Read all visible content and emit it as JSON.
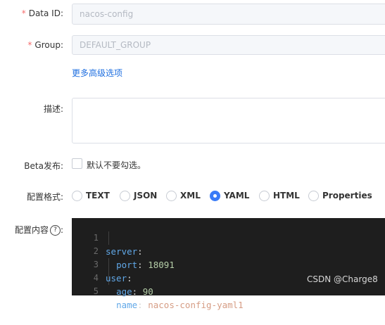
{
  "form": {
    "data_id": {
      "required_mark": "*",
      "label": "Data ID:",
      "value": "nacos-config"
    },
    "group": {
      "required_mark": "*",
      "label": "Group:",
      "value": "DEFAULT_GROUP"
    },
    "advanced_link": "更多高级选项",
    "description": {
      "label": "描述:",
      "value": ""
    },
    "beta": {
      "label": "Beta发布:",
      "checkbox_label": "默认不要勾选。",
      "checked": false
    },
    "format": {
      "label": "配置格式:",
      "options": [
        "TEXT",
        "JSON",
        "XML",
        "YAML",
        "HTML",
        "Properties"
      ],
      "selected": "YAML"
    },
    "content": {
      "label": "配置内容",
      "help_icon": "question-circle-icon",
      "lines": [
        {
          "num": "1",
          "key": "server",
          "sep": ":",
          "value": ""
        },
        {
          "num": "2",
          "key": "port",
          "sep": ": ",
          "value": "18091"
        },
        {
          "num": "3",
          "key": "user",
          "sep": ":",
          "value": ""
        },
        {
          "num": "4",
          "key": "age",
          "sep": ": ",
          "value": "90"
        },
        {
          "num": "5",
          "key": "name",
          "sep": ": ",
          "value": "nacos-config-yaml1"
        }
      ]
    }
  },
  "watermark": "CSDN @Charge8",
  "colors": {
    "accent": "#3a7bf7",
    "required": "#f56c6c",
    "editor_bg": "#1e1e1e",
    "yaml_key": "#61a8e8"
  }
}
